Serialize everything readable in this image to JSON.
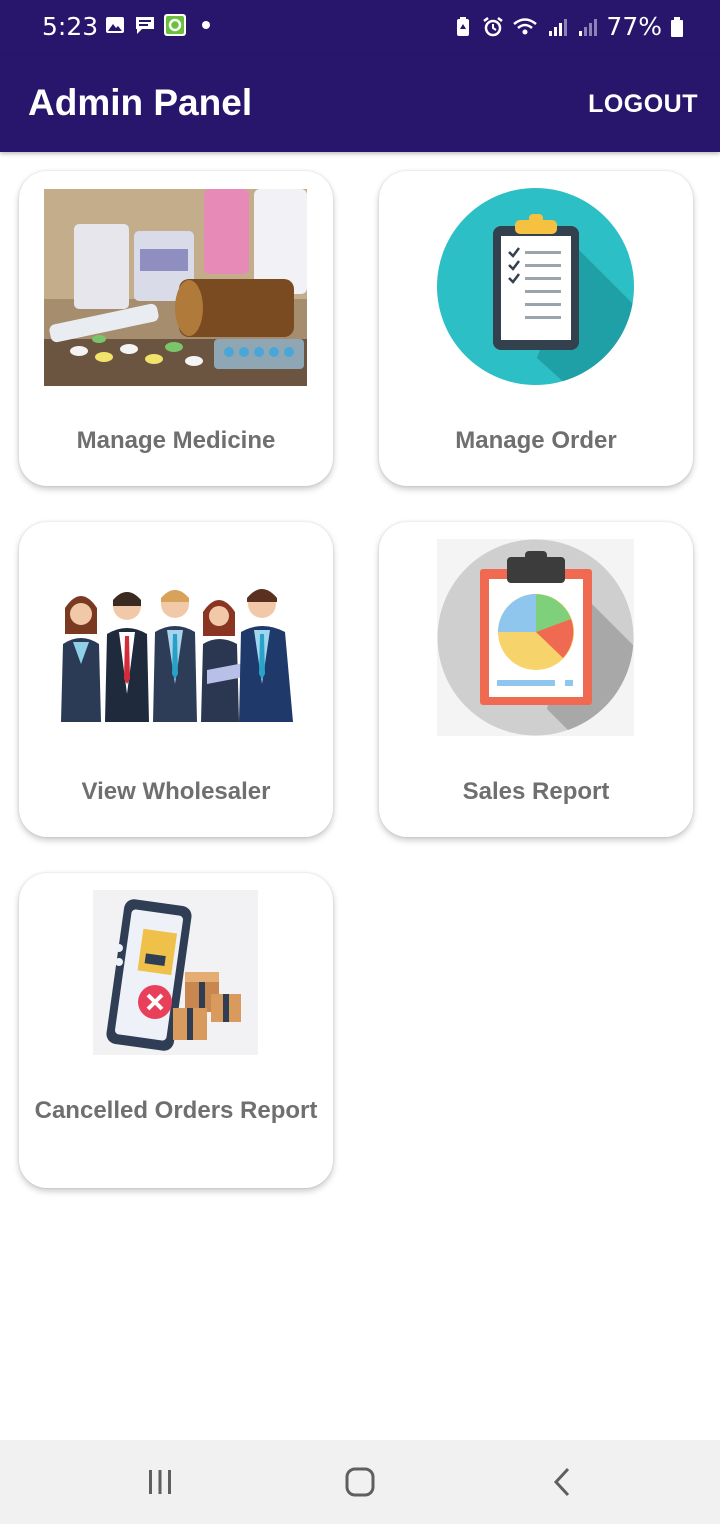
{
  "status_bar": {
    "time": "5:23",
    "battery_percent": "77%",
    "left_icons": [
      "gallery-icon",
      "message-icon",
      "app-icon"
    ],
    "right_icons": [
      "battery-saver-icon",
      "alarm-icon",
      "wifi-icon",
      "signal-icon",
      "signal-icon",
      "battery-icon"
    ]
  },
  "header": {
    "title": "Admin Panel",
    "logout_label": "LOGOUT"
  },
  "menu": {
    "items": [
      {
        "label": "Manage Medicine",
        "icon": "medicine-image"
      },
      {
        "label": "Manage Order",
        "icon": "clipboard-icon"
      },
      {
        "label": "View Wholesaler",
        "icon": "people-group-image"
      },
      {
        "label": "Sales Report",
        "icon": "pie-chart-report-icon"
      },
      {
        "label": "Cancelled Orders Report",
        "icon": "cancelled-order-icon"
      }
    ]
  },
  "colors": {
    "primary": "#27166b",
    "label": "#6f6f6f",
    "teal": "#2cbfc5",
    "nav_bg": "#f1f1f1"
  },
  "nav_bar": {
    "buttons": [
      "recent-apps-icon",
      "home-icon",
      "back-icon"
    ]
  }
}
